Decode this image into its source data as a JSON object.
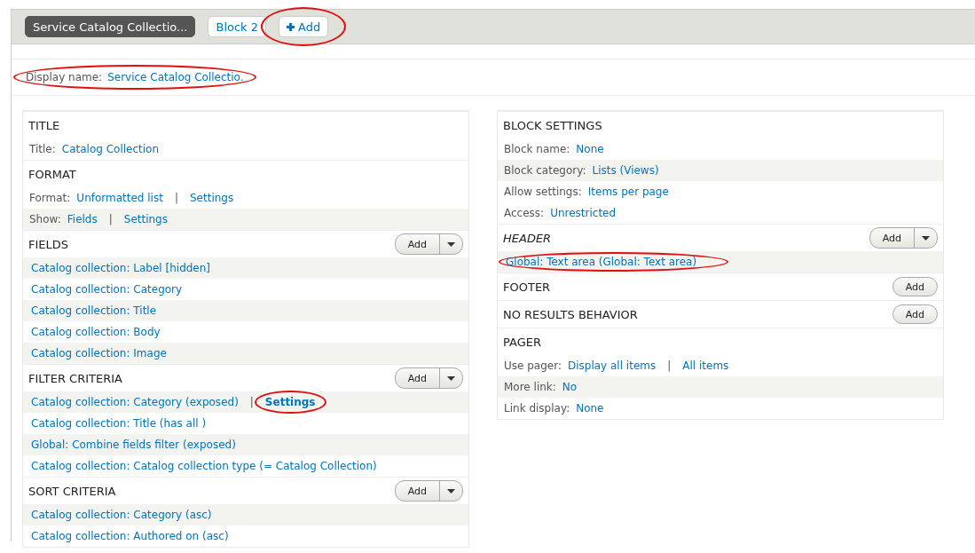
{
  "tabs": [
    {
      "kind": "tab",
      "label": "Service Catalog Collectio...",
      "selected": true,
      "circled": false
    },
    {
      "kind": "tab",
      "label": "Block 2",
      "selected": false,
      "circled": false
    },
    {
      "kind": "add",
      "label": "Add",
      "selected": false,
      "circled": true
    }
  ],
  "display_name": {
    "label": "Display name:",
    "value": "Service Catalog Collectio.",
    "circled": true
  },
  "columns": [
    [
      {
        "title": "TITLE",
        "italic": false,
        "rows": [
          {
            "label": "Title:",
            "shaded": false,
            "circled": false,
            "links": [
              {
                "text": "Catalog Collection",
                "bold": false,
                "circled": false
              }
            ]
          }
        ]
      },
      {
        "title": "FORMAT",
        "italic": false,
        "rows": [
          {
            "label": "Format:",
            "shaded": false,
            "circled": false,
            "separator": "|",
            "links": [
              {
                "text": "Unformatted list",
                "bold": false,
                "circled": false
              },
              {
                "text": "Settings",
                "bold": false,
                "circled": false
              }
            ]
          },
          {
            "label": "Show:",
            "shaded": true,
            "circled": false,
            "separator": "|",
            "links": [
              {
                "text": "Fields",
                "bold": false,
                "circled": false
              },
              {
                "text": "Settings",
                "bold": false,
                "circled": false
              }
            ]
          }
        ]
      },
      {
        "title": "FIELDS",
        "italic": false,
        "add_button": {
          "label": "Add",
          "dropdown": true
        },
        "rows": [
          {
            "shaded": true,
            "circled": false,
            "links": [
              {
                "text": "Catalog collection: Label [hidden]",
                "bold": false,
                "circled": false
              }
            ]
          },
          {
            "shaded": false,
            "circled": false,
            "links": [
              {
                "text": "Catalog collection: Category",
                "bold": false,
                "circled": false
              }
            ]
          },
          {
            "shaded": true,
            "circled": false,
            "links": [
              {
                "text": "Catalog collection: Title",
                "bold": false,
                "circled": false
              }
            ]
          },
          {
            "shaded": false,
            "circled": false,
            "links": [
              {
                "text": "Catalog collection: Body",
                "bold": false,
                "circled": false
              }
            ]
          },
          {
            "shaded": true,
            "circled": false,
            "links": [
              {
                "text": "Catalog collection: Image",
                "bold": false,
                "circled": false
              }
            ]
          }
        ]
      },
      {
        "title": "FILTER CRITERIA",
        "italic": false,
        "add_button": {
          "label": "Add",
          "dropdown": true
        },
        "rows": [
          {
            "shaded": true,
            "circled": false,
            "separator": "|",
            "links": [
              {
                "text": "Catalog collection: Category (exposed)",
                "bold": false,
                "circled": false
              },
              {
                "text": "Settings",
                "bold": true,
                "circled": true
              }
            ]
          },
          {
            "shaded": false,
            "circled": false,
            "links": [
              {
                "text": "Catalog collection: Title (has all )",
                "bold": false,
                "circled": false
              }
            ]
          },
          {
            "shaded": true,
            "circled": false,
            "links": [
              {
                "text": "Global: Combine fields filter (exposed)",
                "bold": false,
                "circled": false
              }
            ]
          },
          {
            "shaded": false,
            "circled": false,
            "links": [
              {
                "text": "Catalog collection: Catalog collection type (= Catalog Collection)",
                "bold": false,
                "circled": false
              }
            ]
          }
        ]
      },
      {
        "title": "SORT CRITERIA",
        "italic": false,
        "add_button": {
          "label": "Add",
          "dropdown": true
        },
        "rows": [
          {
            "shaded": true,
            "circled": false,
            "links": [
              {
                "text": "Catalog collection: Category (asc)",
                "bold": false,
                "circled": false
              }
            ]
          },
          {
            "shaded": false,
            "circled": false,
            "links": [
              {
                "text": "Catalog collection: Authored on (asc)",
                "bold": false,
                "circled": false
              }
            ]
          }
        ]
      }
    ],
    [
      {
        "title": "BLOCK SETTINGS",
        "italic": false,
        "rows": [
          {
            "label": "Block name:",
            "shaded": false,
            "circled": false,
            "links": [
              {
                "text": "None",
                "bold": false,
                "circled": false
              }
            ]
          },
          {
            "label": "Block category:",
            "shaded": true,
            "circled": false,
            "links": [
              {
                "text": "Lists (Views)",
                "bold": false,
                "circled": false
              }
            ]
          },
          {
            "label": "Allow settings:",
            "shaded": false,
            "circled": false,
            "links": [
              {
                "text": "Items per page",
                "bold": false,
                "circled": false
              }
            ]
          },
          {
            "label": "Access:",
            "shaded": false,
            "circled": false,
            "links": [
              {
                "text": "Unrestricted",
                "bold": false,
                "circled": false
              }
            ]
          }
        ]
      },
      {
        "title": "HEADER",
        "italic": true,
        "add_button": {
          "label": "Add",
          "dropdown": true
        },
        "rows": [
          {
            "shaded": true,
            "circled": true,
            "links": [
              {
                "text": "Global: Text area (Global: Text area)",
                "bold": false,
                "circled": false
              }
            ]
          }
        ]
      },
      {
        "title": "FOOTER",
        "italic": false,
        "add_button": {
          "label": "Add",
          "dropdown": false
        }
      },
      {
        "title": "NO RESULTS BEHAVIOR",
        "italic": false,
        "add_button": {
          "label": "Add",
          "dropdown": false
        }
      },
      {
        "title": "PAGER",
        "italic": false,
        "rows": [
          {
            "label": "Use pager:",
            "shaded": false,
            "circled": false,
            "separator": "|",
            "links": [
              {
                "text": "Display all items",
                "bold": false,
                "circled": false
              },
              {
                "text": "All items",
                "bold": false,
                "circled": false
              }
            ]
          },
          {
            "label": "More link:",
            "shaded": true,
            "circled": false,
            "links": [
              {
                "text": "No",
                "bold": false,
                "circled": false
              }
            ]
          },
          {
            "label": "Link display:",
            "shaded": false,
            "circled": false,
            "links": [
              {
                "text": "None",
                "bold": false,
                "circled": false
              }
            ]
          }
        ]
      }
    ]
  ]
}
